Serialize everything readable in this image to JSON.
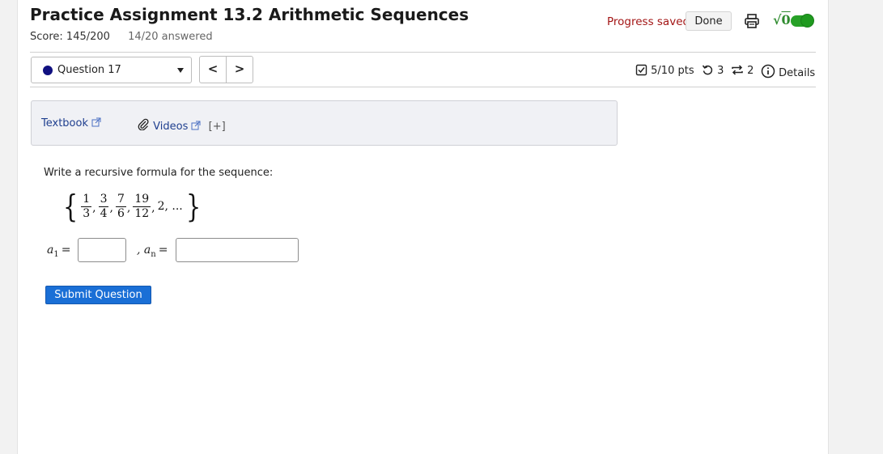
{
  "header": {
    "title": "Practice Assignment 13.2 Arithmetic Sequences",
    "score": "Score: 145/200",
    "answered": "14/20 answered",
    "progress_saved": "Progress saved",
    "done_label": "Done",
    "icons": [
      "printer-icon",
      "math-symbol-icon",
      "toggle-switch"
    ],
    "colors": {
      "progress_saved": "#a31515",
      "toggle": "#27a127"
    }
  },
  "question_nav": {
    "selected": "Question 17",
    "prev_label": "<",
    "next_label": ">",
    "points": "5/10 pts",
    "retries": "3",
    "attempts": "2",
    "details_label": "Details"
  },
  "resources": {
    "textbook": "Textbook",
    "videos": "Videos",
    "expand": "[+]"
  },
  "question": {
    "prompt": "Write a recursive formula for the sequence:",
    "sequence": {
      "open": "{",
      "terms": [
        {
          "num": "1",
          "den": "3"
        },
        {
          "num": "3",
          "den": "4"
        },
        {
          "num": "7",
          "den": "6"
        },
        {
          "num": "19",
          "den": "12"
        }
      ],
      "tail": "2, ...",
      "close": "}"
    },
    "a1_label": "a",
    "a1_sub": "1",
    "an_label": "a",
    "an_sub": "n",
    "equals": "=",
    "separator": ",",
    "a1_value": "",
    "an_value": ""
  },
  "submit_label": "Submit Question"
}
